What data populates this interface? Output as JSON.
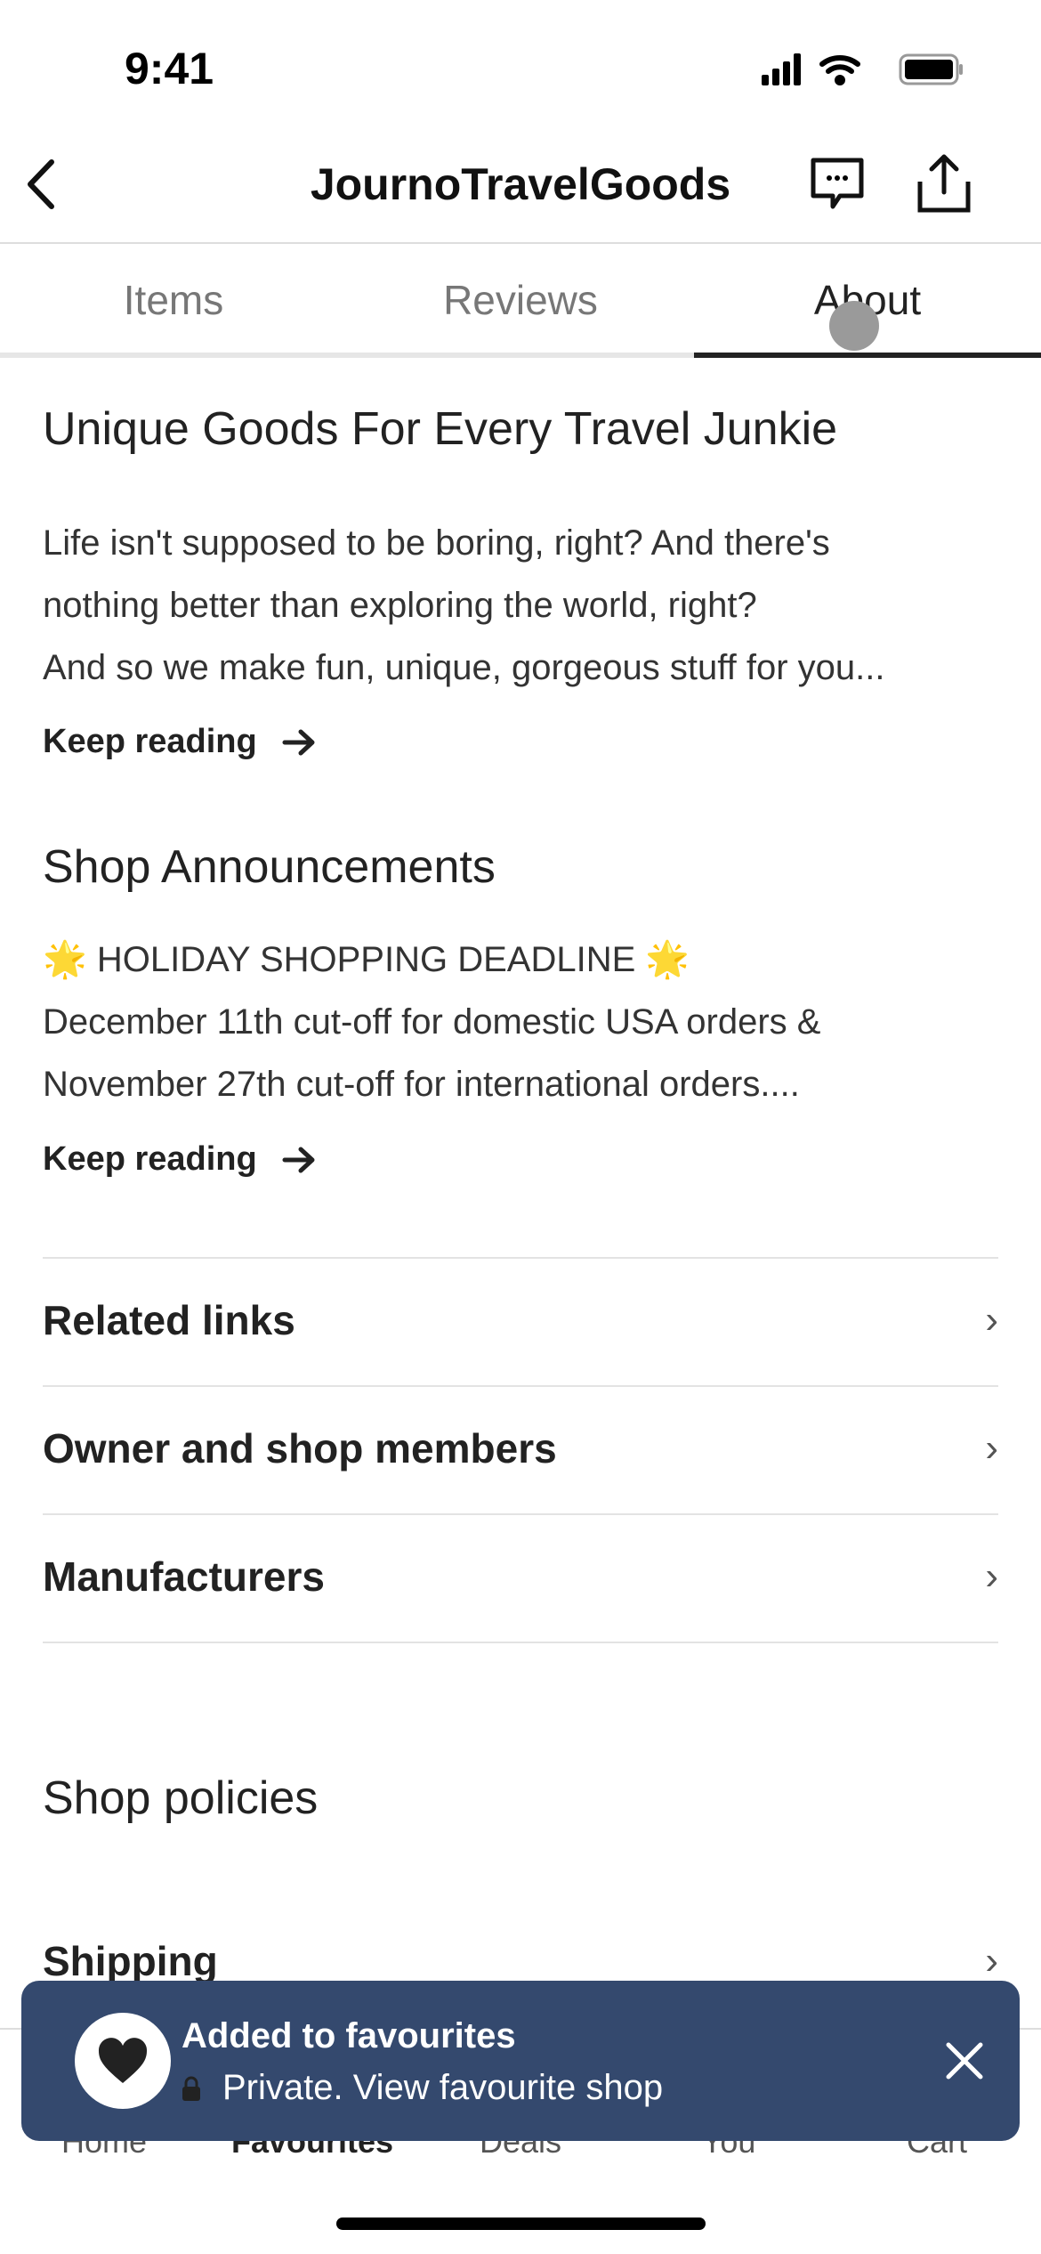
{
  "status_bar": {
    "time": "9:41"
  },
  "header": {
    "title": "JournoTravelGoods"
  },
  "tabs": [
    {
      "label": "Items"
    },
    {
      "label": "Reviews"
    },
    {
      "label": "About",
      "active": true
    }
  ],
  "about": {
    "heading": "Unique Goods For Every Travel Junkie",
    "lines": [
      "Life isn't supposed to be boring, right? And there's",
      "nothing better than exploring the world, right?",
      "And so we make fun, unique, gorgeous stuff for you..."
    ],
    "keep_reading": "Keep reading"
  },
  "announcements": {
    "heading": "Shop Announcements",
    "lines": [
      "🌟 HOLIDAY SHOPPING DEADLINE 🌟",
      "December 11th cut-off for domestic USA orders &",
      "November 27th cut-off for international orders...."
    ],
    "keep_reading": "Keep reading"
  },
  "links": [
    {
      "label": "Related links"
    },
    {
      "label": "Owner and shop members"
    },
    {
      "label": "Manufacturers"
    }
  ],
  "policies": {
    "heading": "Shop policies",
    "items": [
      {
        "label": "Shipping"
      }
    ]
  },
  "bottom_nav": [
    {
      "label": "Home"
    },
    {
      "label": "Favourites",
      "active": true
    },
    {
      "label": "Deals"
    },
    {
      "label": "You"
    },
    {
      "label": "Cart"
    }
  ],
  "toast": {
    "title": "Added to favourites",
    "subtitle": "Private. View favourite shop",
    "color": "#34496e"
  }
}
